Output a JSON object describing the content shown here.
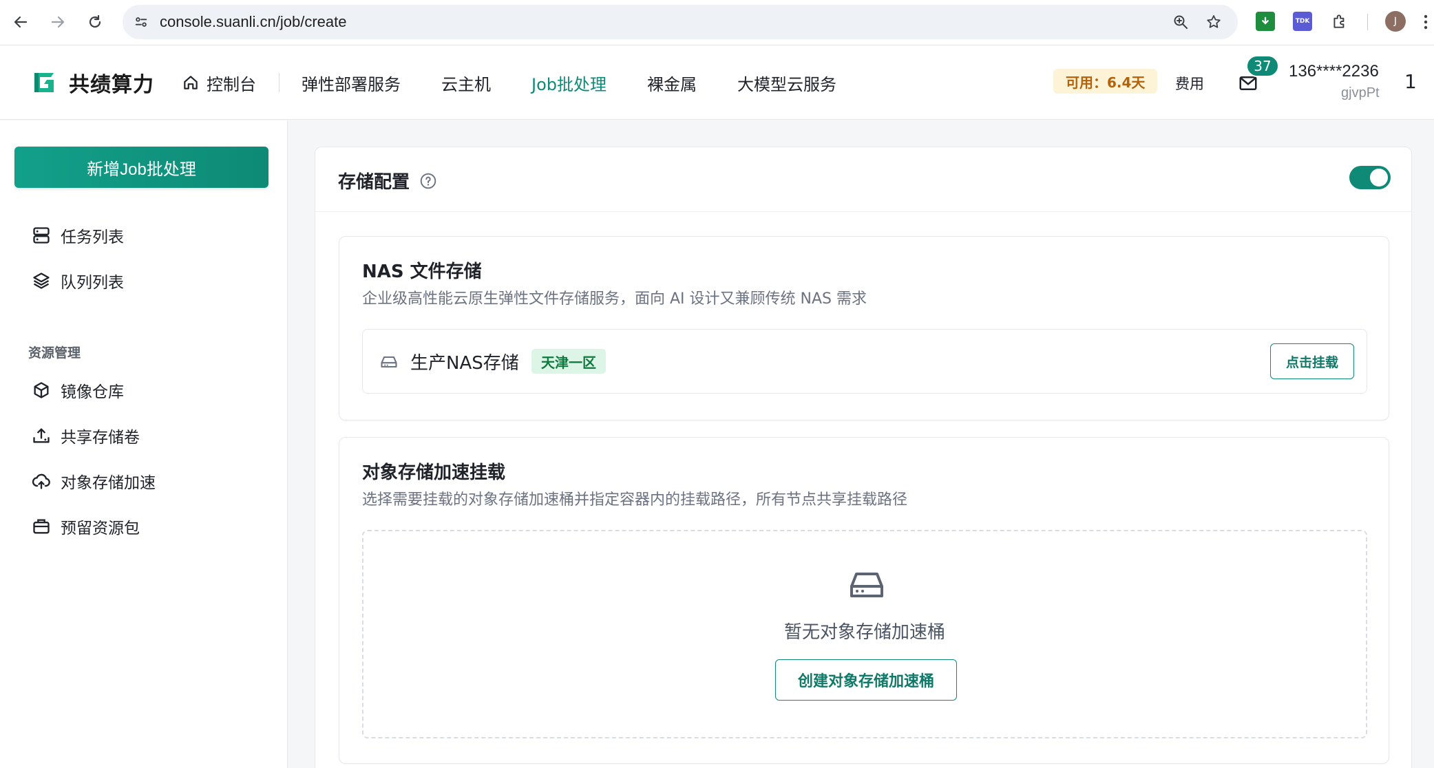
{
  "browser": {
    "url": "console.suanli.cn/job/create",
    "profile_initial": "J",
    "ext_tdk_label": "TDK"
  },
  "header": {
    "logo_text": "共绩算力",
    "nav": [
      {
        "label": "控制台",
        "icon": "home-icon"
      },
      {
        "label": "弹性部署服务"
      },
      {
        "label": "云主机"
      },
      {
        "label": "Job批处理",
        "active": true
      },
      {
        "label": "裸金属"
      },
      {
        "label": "大模型云服务"
      }
    ],
    "available_label": "可用：6.4天",
    "fee_label": "费用",
    "mail_badge": "37",
    "user_phone": "136****2236",
    "user_name": "gjvpPt",
    "user_count": "1"
  },
  "sidebar": {
    "new_button": "新增Job批处理",
    "items_top": [
      {
        "label": "任务列表",
        "icon": "server-list-icon"
      },
      {
        "label": "队列列表",
        "icon": "layers-icon"
      }
    ],
    "group_title": "资源管理",
    "items_resources": [
      {
        "label": "镜像仓库",
        "icon": "box-icon"
      },
      {
        "label": "共享存储卷",
        "icon": "upload-tray-icon"
      },
      {
        "label": "对象存储加速",
        "icon": "cloud-upload-icon"
      },
      {
        "label": "预留资源包",
        "icon": "package-icon"
      }
    ]
  },
  "main": {
    "title": "存储配置",
    "toggle_on": true,
    "nas": {
      "title": "NAS 文件存储",
      "description": "企业级高性能云原生弹性文件存储服务，面向 AI 设计又兼顾传统 NAS 需求",
      "storage_name": "生产NAS存储",
      "region": "天津一区",
      "mount_button": "点击挂载"
    },
    "object": {
      "title": "对象存储加速挂载",
      "description": "选择需要挂载的对象存储加速桶并指定容器内的挂载路径，所有节点共享挂载路径",
      "empty_text": "暂无对象存储加速桶",
      "create_button": "创建对象存储加速桶"
    }
  },
  "colors": {
    "accent": "#0f8a77",
    "tag_bg": "#dcf5e6",
    "avail_bg": "#fdf3d6"
  }
}
